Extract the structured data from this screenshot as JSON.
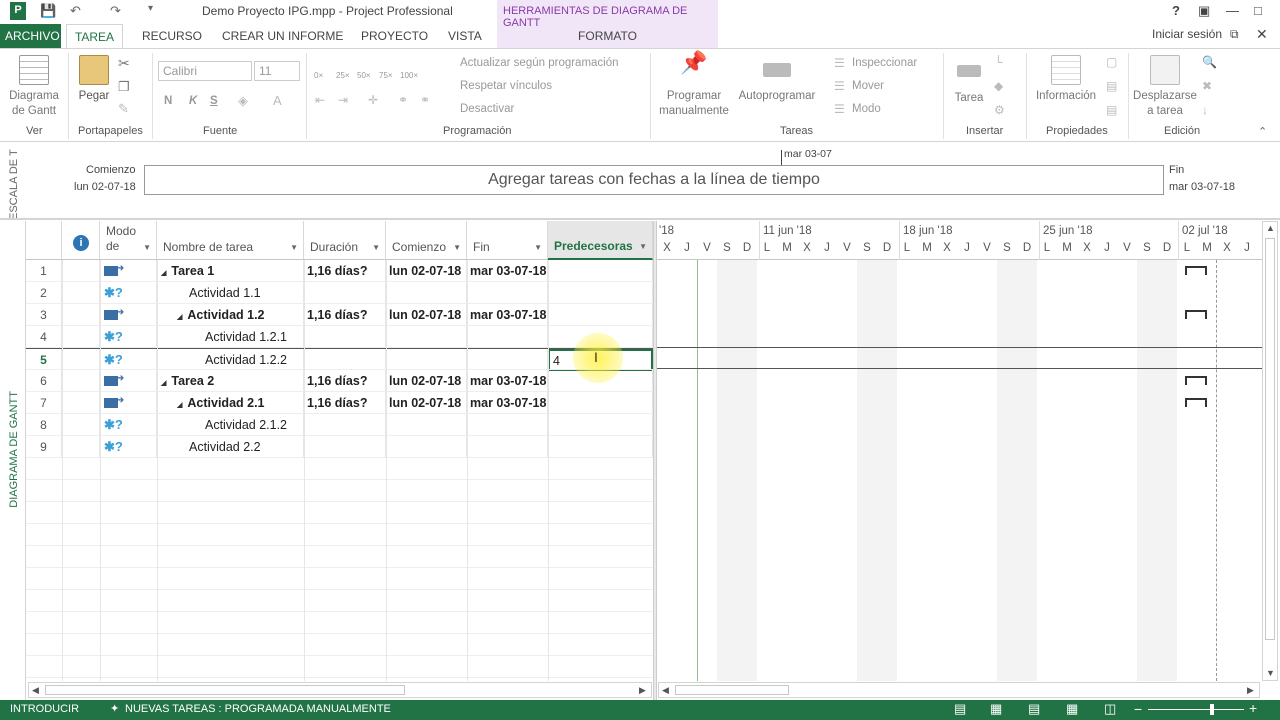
{
  "window": {
    "title": "Demo Proyecto IPG.mpp - Project Professional",
    "context_tab_group": "HERRAMIENTAS DE DIAGRAMA DE GANTT",
    "sign_in": "Iniciar sesión",
    "help": "?"
  },
  "tabs": [
    "ARCHIVO",
    "TAREA",
    "RECURSO",
    "CREAR UN INFORME",
    "PROYECTO",
    "VISTA",
    "FORMATO"
  ],
  "ribbon": {
    "ver": {
      "button": "Diagrama de Gantt",
      "group": "Ver"
    },
    "portapapeles": {
      "paste": "Pegar",
      "group": "Portapapeles"
    },
    "fuente": {
      "font": "Calibri",
      "size": "11",
      "bold": "N",
      "italic": "K",
      "underline": "S",
      "group": "Fuente"
    },
    "programacion": {
      "percents": [
        "0×",
        "25×",
        "50×",
        "75×",
        "100×"
      ],
      "actualizar": "Actualizar según programación",
      "respetar": "Respetar vínculos",
      "desactivar": "Desactivar",
      "group": "Programación"
    },
    "tareas": {
      "manual": "Programar manualmente",
      "auto": "Autoprogramar",
      "inspeccionar": "Inspeccionar",
      "mover": "Mover",
      "modo": "Modo",
      "group": "Tareas"
    },
    "insertar": {
      "tarea": "Tarea",
      "group": "Insertar"
    },
    "propiedades": {
      "info": "Información",
      "group": "Propiedades"
    },
    "edicion": {
      "desplazarse": "Desplazarse a tarea",
      "group": "Edición"
    }
  },
  "timeline": {
    "side_label": "ESCALA DE T",
    "start_label": "Comienzo",
    "start_date": "lun 02-07-18",
    "end_label": "Fin",
    "end_date": "mar 03-07-18",
    "today_marker": "mar 03-07",
    "placeholder": "Agregar tareas con fechas a la línea de tiempo"
  },
  "gantt_side_label": "DIAGRAMA DE GANTT",
  "grid": {
    "columns": [
      "Modo de",
      "Nombre de tarea",
      "Duración",
      "Comienzo",
      "Fin",
      "Predecesoras"
    ],
    "rows": [
      {
        "n": "1",
        "mode": "auto",
        "name": "Tarea 1",
        "dur": "1,16 días?",
        "start": "lun 02-07-18",
        "end": "mar 03-07-18",
        "pred": "",
        "summary": true,
        "indent": 0
      },
      {
        "n": "2",
        "mode": "manual",
        "name": "Actividad 1.1",
        "dur": "",
        "start": "",
        "end": "",
        "pred": "",
        "summary": false,
        "indent": 1
      },
      {
        "n": "3",
        "mode": "auto",
        "name": "Actividad 1.2",
        "dur": "1,16 días?",
        "start": "lun 02-07-18",
        "end": "mar 03-07-18",
        "pred": "",
        "summary": true,
        "indent": 1
      },
      {
        "n": "4",
        "mode": "manual",
        "name": "Actividad 1.2.1",
        "dur": "",
        "start": "",
        "end": "",
        "pred": "",
        "summary": false,
        "indent": 2
      },
      {
        "n": "5",
        "mode": "manual",
        "name": "Actividad 1.2.2",
        "dur": "",
        "start": "",
        "end": "",
        "pred": "4",
        "summary": false,
        "indent": 2
      },
      {
        "n": "6",
        "mode": "auto",
        "name": "Tarea 2",
        "dur": "1,16 días?",
        "start": "lun 02-07-18",
        "end": "mar 03-07-18",
        "pred": "",
        "summary": true,
        "indent": 0
      },
      {
        "n": "7",
        "mode": "auto",
        "name": "Actividad 2.1",
        "dur": "1,16 días?",
        "start": "lun 02-07-18",
        "end": "mar 03-07-18",
        "pred": "",
        "summary": true,
        "indent": 1
      },
      {
        "n": "8",
        "mode": "manual",
        "name": "Actividad 2.1.2",
        "dur": "",
        "start": "",
        "end": "",
        "pred": "",
        "summary": false,
        "indent": 2
      },
      {
        "n": "9",
        "mode": "manual",
        "name": "Actividad 2.2",
        "dur": "",
        "start": "",
        "end": "",
        "pred": "",
        "summary": false,
        "indent": 1
      }
    ]
  },
  "gantt": {
    "weeks": [
      "'18",
      "11 jun '18",
      "18 jun '18",
      "25 jun '18",
      "02 jul '18"
    ],
    "days": [
      "X",
      "J",
      "V",
      "S",
      "D",
      "L",
      "M",
      "X",
      "J",
      "V",
      "S",
      "D",
      "L",
      "M",
      "X",
      "J",
      "V",
      "S",
      "D",
      "L",
      "M",
      "X",
      "J",
      "V",
      "S",
      "D",
      "L",
      "M",
      "X",
      "J"
    ]
  },
  "status": {
    "mode": "INTRODUCIR",
    "new_tasks": "NUEVAS TAREAS : PROGRAMADA MANUALMENTE"
  },
  "colors": {
    "accent": "#217346",
    "context": "#8a3aa8"
  }
}
